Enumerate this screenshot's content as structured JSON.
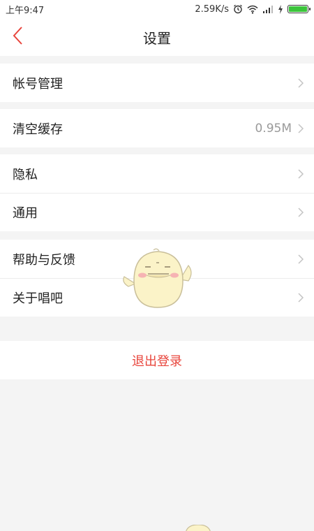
{
  "status_bar": {
    "time": "上午9:47",
    "network_speed": "2.59K/s",
    "icons": [
      "alarm-icon",
      "wifi-icon",
      "signal-icon",
      "charging-icon",
      "battery-icon"
    ],
    "battery_level": 1.0
  },
  "nav": {
    "title": "设置",
    "back_icon": "chevron-left-icon"
  },
  "groups": [
    {
      "items": [
        {
          "label": "帐号管理"
        }
      ]
    },
    {
      "items": [
        {
          "label": "清空缓存",
          "value": "0.95M"
        }
      ]
    },
    {
      "items": [
        {
          "label": "隐私"
        },
        {
          "label": "通用"
        }
      ]
    },
    {
      "items": [
        {
          "label": "帮助与反馈"
        },
        {
          "label": "关于唱吧"
        }
      ]
    }
  ],
  "logout_label": "退出登录",
  "colors": {
    "accent": "#e8453c",
    "background": "#f4f4f4",
    "row_background": "#ffffff",
    "battery": "#3bc43b"
  }
}
